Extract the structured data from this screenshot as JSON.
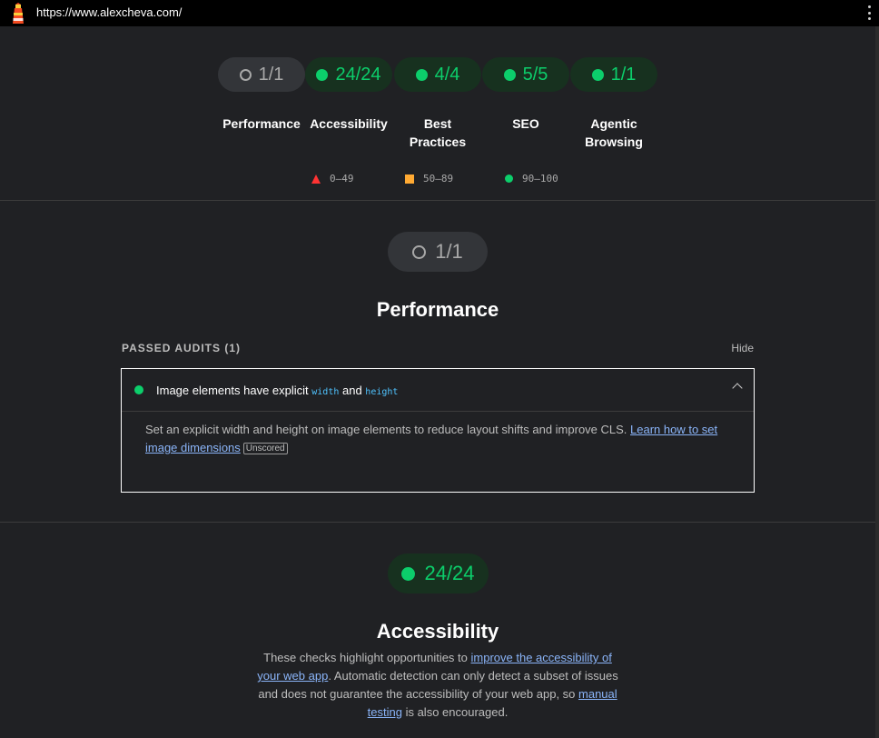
{
  "browser": {
    "url": "https://www.alexcheva.com/"
  },
  "gauges": [
    {
      "score": "1/1",
      "label": "Performance",
      "status": "na"
    },
    {
      "score": "24/24",
      "label": "Accessibility",
      "status": "pass"
    },
    {
      "score": "4/4",
      "label": "Best Practices",
      "status": "pass"
    },
    {
      "score": "5/5",
      "label": "SEO",
      "status": "pass"
    },
    {
      "score": "1/1",
      "label": "Agentic Browsing",
      "status": "pass"
    }
  ],
  "legend": {
    "fail": "0–49",
    "average": "50–89",
    "pass": "90–100"
  },
  "performance": {
    "score": "1/1",
    "title": "Performance",
    "passed_header": "PASSED AUDITS (1)",
    "hide_label": "Hide",
    "audit": {
      "title_prefix": "Image elements have explicit ",
      "code1": "width",
      "title_mid": " and ",
      "code2": "height",
      "description": "Set an explicit width and height on image elements to reduce layout shifts and improve CLS. ",
      "link_text": "Learn how to set image dimensions",
      "badge": "Unscored"
    }
  },
  "accessibility": {
    "score": "24/24",
    "title": "Accessibility",
    "desc_part1": "These checks highlight opportunities to ",
    "link1": "improve the accessibility of your web app",
    "desc_part2": ". Automatic detection can only detect a subset of issues and does not guarantee the accessibility of your web app, so ",
    "link2": "manual testing",
    "desc_part3": " is also encouraged."
  },
  "colors": {
    "pass": "#0cce6b",
    "average": "#ffaa33",
    "fail": "#ff3333",
    "background": "#202124"
  }
}
